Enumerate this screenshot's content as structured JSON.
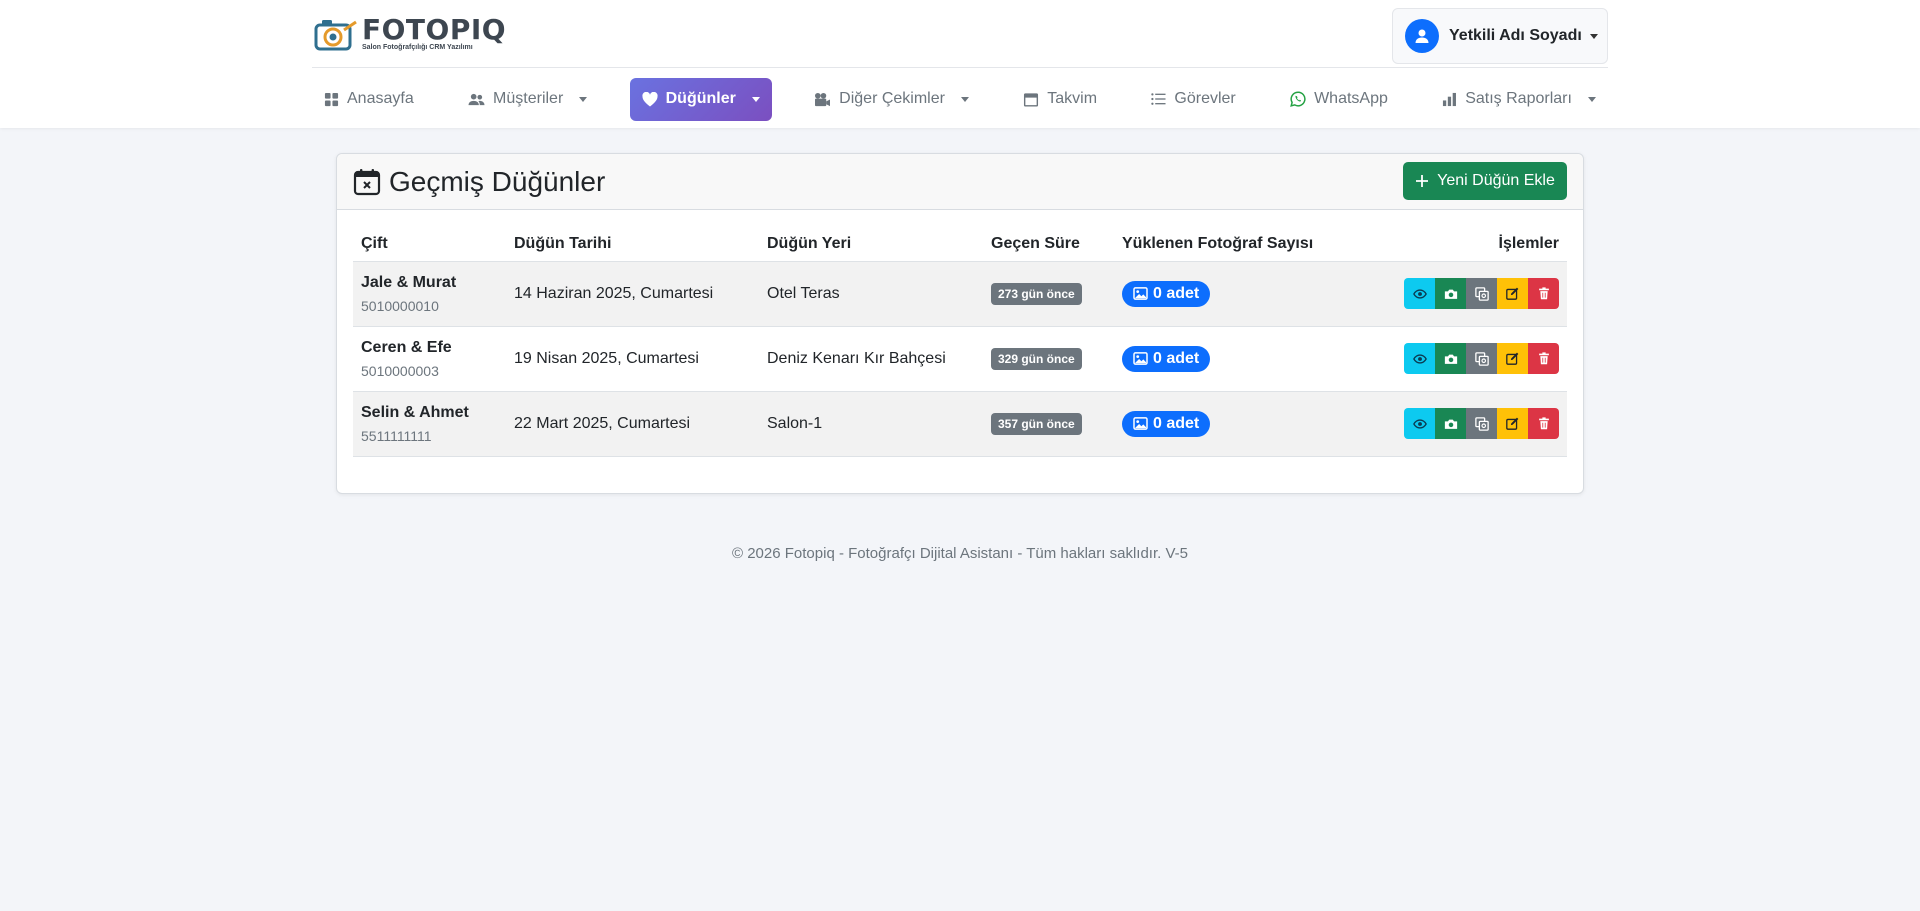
{
  "brand": {
    "name": "FOTOPIQ",
    "tagline": "Salon Fotoğrafçılığı CRM Yazılımı"
  },
  "user": {
    "name": "Yetkili Adı Soyadı"
  },
  "nav": {
    "items": [
      {
        "label": "Anasayfa",
        "icon": "grid-icon",
        "dropdown": false
      },
      {
        "label": "Müşteriler",
        "icon": "users-icon",
        "dropdown": true
      },
      {
        "label": "Düğünler",
        "icon": "heart-icon",
        "dropdown": true,
        "active": true
      },
      {
        "label": "Diğer Çekimler",
        "icon": "video-icon",
        "dropdown": true
      },
      {
        "label": "Takvim",
        "icon": "calendar-icon",
        "dropdown": false
      },
      {
        "label": "Görevler",
        "icon": "list-icon",
        "dropdown": false
      },
      {
        "label": "WhatsApp",
        "icon": "whatsapp-icon",
        "dropdown": false
      },
      {
        "label": "Satış Raporları",
        "icon": "bar-chart-icon",
        "dropdown": true
      }
    ]
  },
  "page": {
    "title": "Geçmiş Düğünler",
    "add_button": "Yeni Düğün Ekle"
  },
  "table": {
    "headers": {
      "couple": "Çift",
      "date": "Düğün Tarihi",
      "venue": "Düğün Yeri",
      "elapsed": "Geçen Süre",
      "photos": "Yüklenen Fotoğraf Sayısı",
      "actions": "İşlemler"
    },
    "rows": [
      {
        "couple": "Jale & Murat",
        "phone": "5010000010",
        "date": "14 Haziran 2025, Cumartesi",
        "venue": "Otel Teras",
        "elapsed": "273 gün önce",
        "photos": "0 adet"
      },
      {
        "couple": "Ceren & Efe",
        "phone": "5010000003",
        "date": "19 Nisan 2025, Cumartesi",
        "venue": "Deniz Kenarı Kır Bahçesi",
        "elapsed": "329 gün önce",
        "photos": "0 adet"
      },
      {
        "couple": "Selin & Ahmet",
        "phone": "5511111111",
        "date": "22 Mart 2025, Cumartesi",
        "venue": "Salon-1",
        "elapsed": "357 gün önce",
        "photos": "0 adet"
      }
    ],
    "action_buttons": [
      {
        "icon": "eye-icon",
        "color": "#0dcaf0"
      },
      {
        "icon": "camera-icon",
        "color": "#198754"
      },
      {
        "icon": "images-icon",
        "color": "#6c757d"
      },
      {
        "icon": "edit-icon",
        "color": "#ffc107"
      },
      {
        "icon": "trash-icon",
        "color": "#dc3545"
      }
    ]
  },
  "footer": {
    "text": "© 2026 Fotopiq - Fotoğrafçı Dijital Asistanı - Tüm hakları saklıdır. V-5"
  },
  "colors": {
    "primary": "#0d6efd",
    "success": "#198754",
    "active_nav_start": "#6a72e0",
    "active_nav_end": "#7b4fc0",
    "background": "#f3f5f9"
  }
}
